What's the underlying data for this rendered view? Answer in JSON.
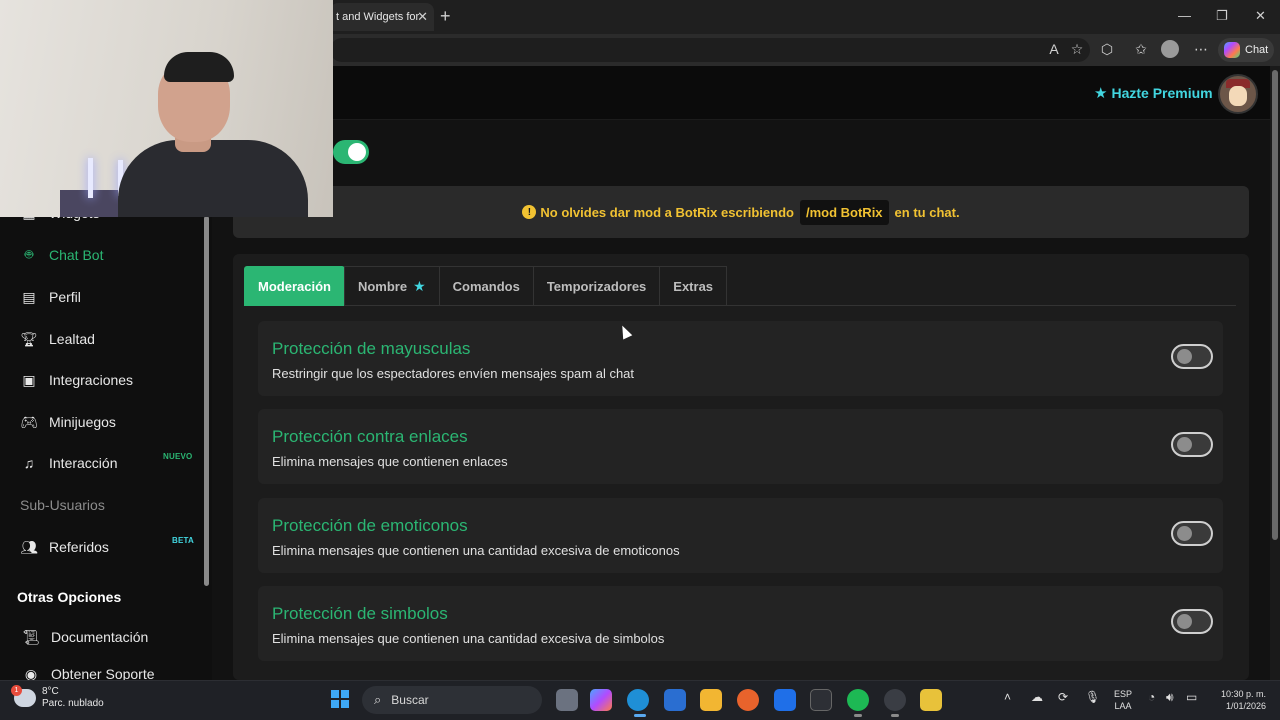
{
  "browser": {
    "tab_title": "t and Widgets for",
    "tab_close": "✕",
    "new_tab": "+",
    "window_controls": {
      "minimize": "—",
      "maximize": "❐",
      "close": "✕"
    },
    "chat_label": "Chat"
  },
  "header": {
    "premium_label": "Hazte Premium",
    "premium_icon": "star-icon"
  },
  "sidebar": {
    "items": [
      {
        "label": "Widgets",
        "icon": "widgets-icon"
      },
      {
        "label": "Chat Bot",
        "icon": "robot-icon",
        "active": true
      },
      {
        "label": "Perfil",
        "icon": "id-card-icon"
      },
      {
        "label": "Lealtad",
        "icon": "trophy-icon"
      },
      {
        "label": "Integraciones",
        "icon": "plug-box-icon"
      },
      {
        "label": "Minijuegos",
        "icon": "gamepad-icon"
      },
      {
        "label": "Interacción",
        "icon": "music-note-icon",
        "badge": "NUEVO"
      },
      {
        "label": "Sub-Usuarios",
        "icon": "",
        "muted": true
      },
      {
        "label": "Referidos",
        "icon": "users-icon",
        "badge": "BETA"
      }
    ],
    "section_title": "Otras Opciones",
    "other_items": [
      {
        "label": "Documentación",
        "icon": "scroll-icon"
      },
      {
        "label": "Obtener Soporte",
        "icon": "support-icon"
      }
    ]
  },
  "notice": {
    "prefix": "No olvides dar mod a BotRix escribiendo",
    "command": "/mod BotRix",
    "suffix": "en tu chat."
  },
  "tabs": [
    {
      "label": "Moderación",
      "active": true
    },
    {
      "label": "Nombre",
      "star": true
    },
    {
      "label": "Comandos"
    },
    {
      "label": "Temporizadores"
    },
    {
      "label": "Extras"
    }
  ],
  "settings": [
    {
      "title": "Protección de mayusculas",
      "description": "Restringir que los espectadores envíen mensajes spam al chat",
      "enabled": false
    },
    {
      "title": "Protección contra enlaces",
      "description": "Elimina mensajes que contienen enlaces",
      "enabled": false
    },
    {
      "title": "Protección de emoticonos",
      "description": "Elimina mensajes que contienen una cantidad excesiva de emoticonos",
      "enabled": false
    },
    {
      "title": "Protección de simbolos",
      "description": "Elimina mensajes que contienen una cantidad excesiva de simbolos",
      "enabled": false
    }
  ],
  "taskbar": {
    "weather_temp": "8°C",
    "weather_desc": "Parc. nublado",
    "weather_badge": "1",
    "search_placeholder": "Buscar",
    "lang_top": "ESP",
    "lang_bottom": "LAA",
    "time": "10:30 p. m.",
    "date": "1/01/2026"
  },
  "colors": {
    "accent": "#2bb673",
    "premium": "#42d6e0",
    "warning": "#f1c232"
  }
}
